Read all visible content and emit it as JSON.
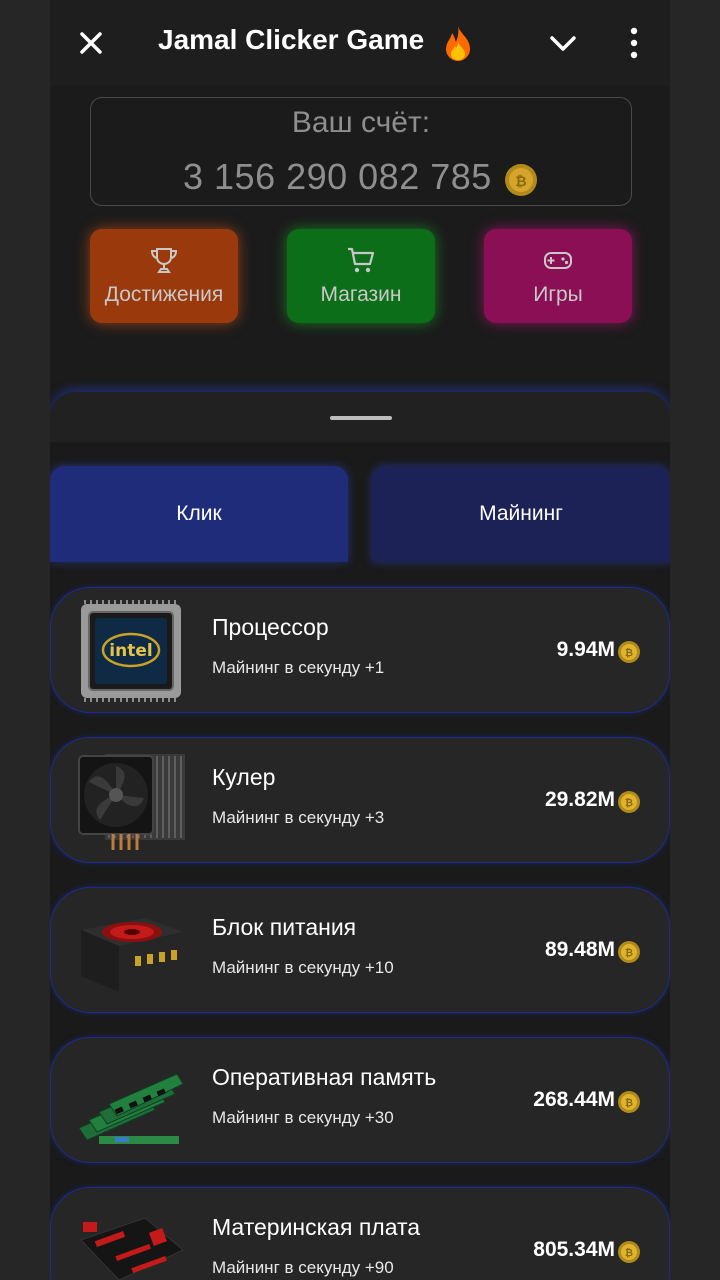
{
  "header": {
    "title": "Jamal Clicker Game",
    "icons": [
      "close-icon",
      "fire-icon",
      "chevron-down-icon",
      "more-vertical-icon"
    ]
  },
  "score": {
    "label": "Ваш счёт:",
    "value": "3 156 290 082 785",
    "icon": "coin-icon"
  },
  "nav": [
    {
      "label": "Достижения",
      "icon": "trophy-icon",
      "color": "#9a3a0c"
    },
    {
      "label": "Магазин",
      "icon": "cart-icon",
      "color": "#0d6e1a"
    },
    {
      "label": "Игры",
      "icon": "gamepad-icon",
      "color": "#8a0f55"
    }
  ],
  "tabs": [
    {
      "label": "Клик"
    },
    {
      "label": "Майнинг"
    }
  ],
  "items": [
    {
      "name": "Процессор",
      "sub": "Майнинг в секунду +1",
      "price": "9.94M",
      "icon": "cpu-icon"
    },
    {
      "name": "Кулер",
      "sub": "Майнинг в секунду +3",
      "price": "29.82M",
      "icon": "cooler-icon"
    },
    {
      "name": "Блок питания",
      "sub": "Майнинг в секунду +10",
      "price": "89.48M",
      "icon": "psu-icon"
    },
    {
      "name": "Оперативная память",
      "sub": "Майнинг в секунду +30",
      "price": "268.44M",
      "icon": "ram-icon"
    },
    {
      "name": "Материнская плата",
      "sub": "Майнинг в секунду +90",
      "price": "805.34M",
      "icon": "motherboard-icon"
    }
  ],
  "colors": {
    "accent_blue": "#1f2a8a",
    "coin": "#d4a017"
  }
}
